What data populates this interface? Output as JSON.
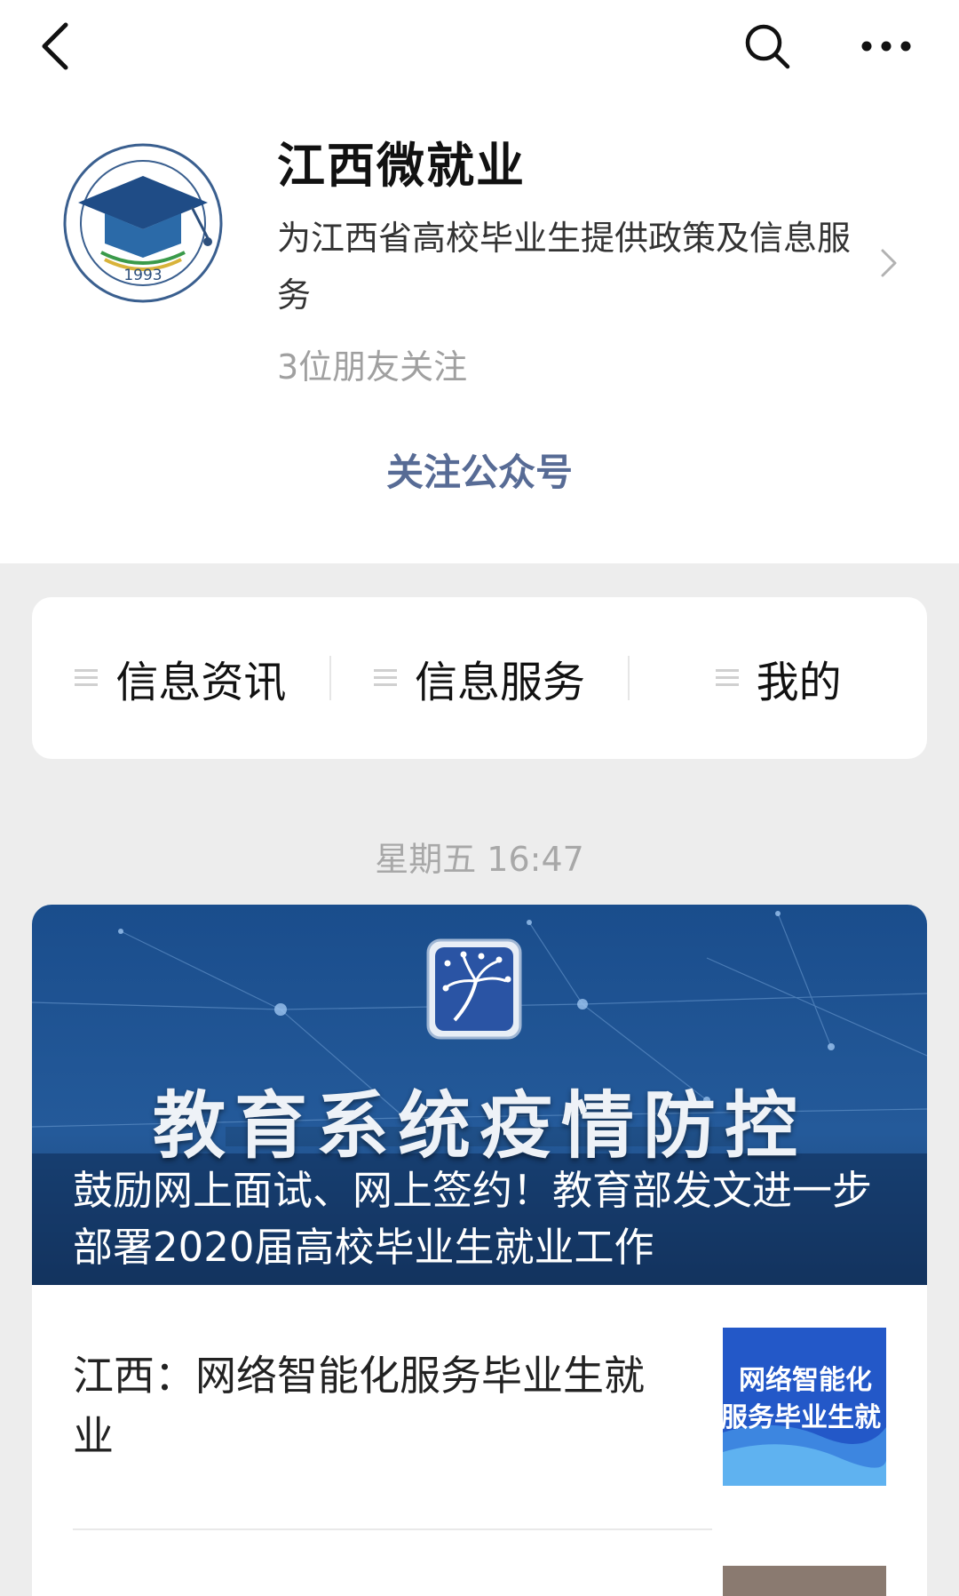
{
  "nav": {
    "back_icon": "chevron-left-icon",
    "search_icon": "search-icon",
    "more_icon": "more-horizontal-icon"
  },
  "profile": {
    "logo_icon": "graduation-cap-seal-logo",
    "logo_year": "1993",
    "name": "江西微就业",
    "description": "为江西省高校毕业生提供政策及信息服务",
    "friends_following": "3位朋友关注",
    "follow_label": "关注公众号"
  },
  "menu": {
    "items": [
      {
        "label": "信息资讯",
        "icon": "menu-lines-icon"
      },
      {
        "label": "信息服务",
        "icon": "menu-lines-icon"
      },
      {
        "label": "我的",
        "icon": "menu-lines-icon"
      }
    ]
  },
  "feed": {
    "timestamp": "星期五 16:47",
    "main_article": {
      "cover_banner_text": "教育系统疫情防控",
      "title": "鼓励网上面试、网上签约！教育部发文进一步部署2020届高校毕业生就业工作"
    },
    "sub_articles": [
      {
        "title": "江西：网络智能化服务毕业生就业",
        "thumb_text_line1": "网络智能化",
        "thumb_text_line2": "服务毕业生就"
      }
    ]
  },
  "colors": {
    "link_blue": "#576b95",
    "cover_blue": "#1d4f8f",
    "page_bg": "#ededed"
  }
}
